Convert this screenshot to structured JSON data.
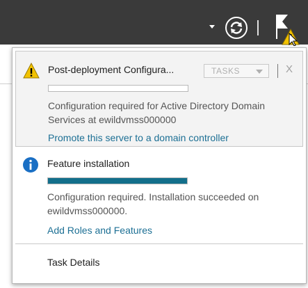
{
  "topbar": {
    "dropdown_icon": "caret-down-icon",
    "refresh_icon": "refresh-icon",
    "flag_icon": "notification-flag-icon",
    "warning_badge_icon": "warning-icon",
    "cursor_icon": "mouse-pointer-icon"
  },
  "notifications": [
    {
      "icon": "warning-icon",
      "title": "Post-deployment Configura...",
      "tasks_label": "TASKS",
      "close_label": "X",
      "progress": 0.0,
      "message": "Configuration required for Active Directory Domain Services at ewildvmss000000",
      "link": "Promote this server to a domain controller"
    },
    {
      "icon": "info-icon",
      "title": "Feature installation",
      "progress": 1.0,
      "message": "Configuration required. Installation succeeded on ewildvmss000000.",
      "link": "Add Roles and Features"
    }
  ],
  "footer": {
    "task_details_label": "Task Details"
  },
  "colors": {
    "topbar_bg": "#3a3a3a",
    "progress_fill": "#136f8b",
    "link": "#1c6f94",
    "warning": "#f2c200",
    "info": "#1a6fc4"
  }
}
